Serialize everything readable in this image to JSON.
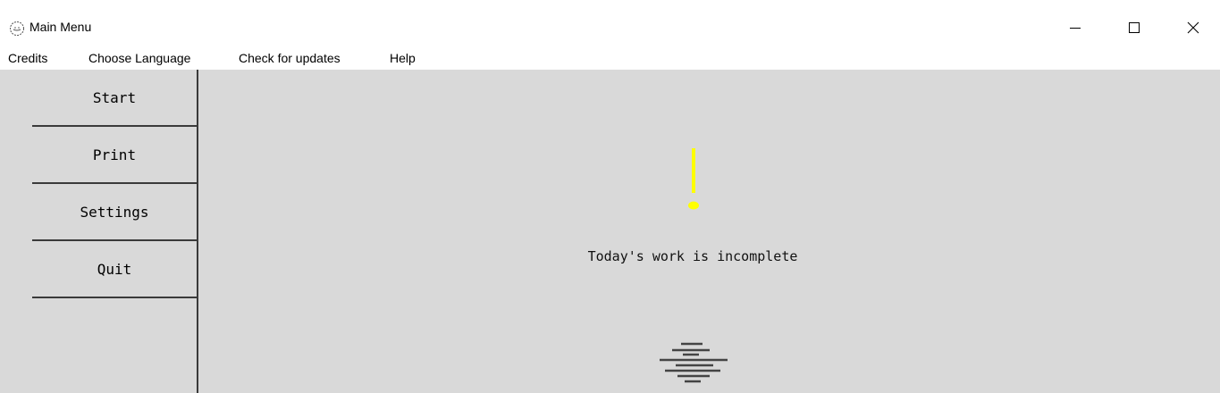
{
  "window": {
    "title": "Main Menu",
    "icon": "app-globe-icon",
    "controls": [
      "minimize-icon",
      "maximize-icon",
      "close-icon"
    ]
  },
  "menubar": {
    "items": [
      {
        "label": "Credits"
      },
      {
        "label": "Choose Language"
      },
      {
        "label": "Check for updates"
      },
      {
        "label": "Help"
      }
    ]
  },
  "sidebar": {
    "buttons": [
      {
        "label": "Start"
      },
      {
        "label": "Print"
      },
      {
        "label": "Settings"
      },
      {
        "label": "Quit"
      }
    ]
  },
  "main": {
    "alert_icon": "exclamation-icon",
    "alert_color": "#ffff00",
    "status": "Today's work is incomplete",
    "loading_icon": "stacked-lines-icon"
  },
  "colors": {
    "client_background": "#d9d9d9",
    "chrome_background": "#ffffff",
    "border": "#3a3a3a"
  }
}
